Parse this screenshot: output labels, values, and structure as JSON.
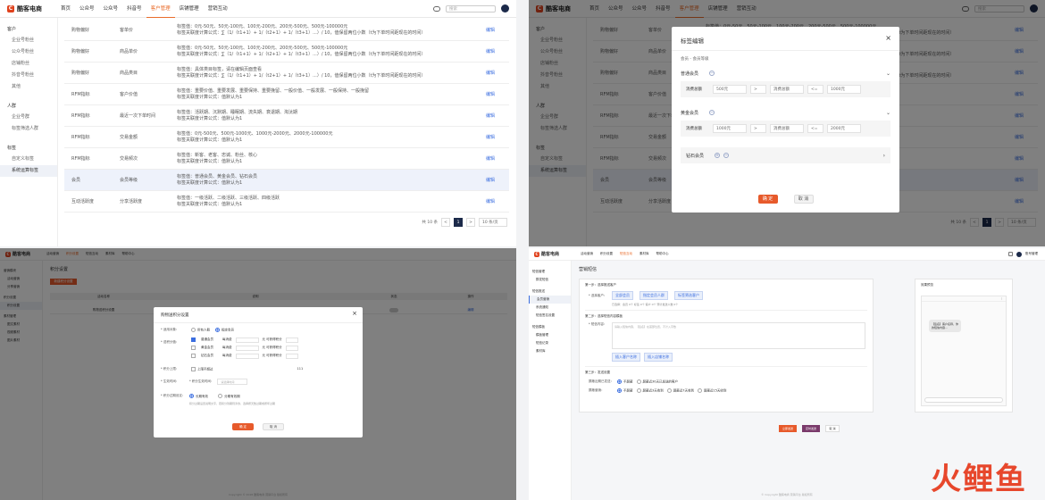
{
  "app": {
    "logo_text": "酷客电商",
    "search_placeholder": "搜索"
  },
  "nav": [
    "首页",
    "公众号",
    "公众号",
    "抖音号",
    "客户管理",
    "店铺管理",
    "营销互动"
  ],
  "nav_active_index": 4,
  "sidebar": {
    "groups": [
      {
        "title": "客户",
        "items": [
          "企业号粉丝",
          "公众号粉丝",
          "店铺粉丝",
          "抖音号粉丝",
          "其他"
        ]
      },
      {
        "title": "人群",
        "items": [
          "企业号群",
          "标签筛选人群"
        ]
      },
      {
        "title": "标签",
        "items": [
          "自定义标签",
          "系统运算标签"
        ]
      }
    ]
  },
  "table_rows": [
    {
      "c1": "购物偏好",
      "c2": "客单价",
      "l1": "标签值：0元-50元、50元-100元、100元-200元、200元-500元、500元-100000元",
      "l2": "标签关联度计算公式：∑（1/（t1+1）+ 1/（t2+1）+ 1/（t3+1）...）/ 10，值保留两位小数（t为下单时间距现在的时间）",
      "edit": "编辑"
    },
    {
      "c1": "购物偏好",
      "c2": "商品单价",
      "l1": "标签值：0元-50元、50元-100元、100元-200元、200元-500元、500元-100000元",
      "l2": "标签关联度计算公式：∑（1/（t1+1）+ 1/（t2+1）+ 1/（t3+1）...）/ 10，值保留两位小数（t为下单时间距现在的时间）",
      "edit": "编辑"
    },
    {
      "c1": "购物偏好",
      "c2": "商品类目",
      "l1": "标签值：具体类目标签，请在编辑页面查看",
      "l2": "标签关联度计算公式：∑（1/（t1+1）+ 1/（t2+1）+ 1/（t3+1）...）/ 10，值保留两位小数（t为下单时间距现在的时间）",
      "edit": "编辑"
    },
    {
      "c1": "RFM指标",
      "c2": "客户价值",
      "l1": "标签值：重要价值、重要发展、重要保持、重要挽留、一般价值、一般发展、一般保持、一般挽留",
      "l2": "标签关联度计算公式：值默认为1",
      "edit": "编辑"
    },
    {
      "c1": "RFM指标",
      "c2": "最近一次下单时间",
      "l1": "标签值：活跃期、沉默期、睡眠期、流失期、衰退期、淘汰期",
      "l2": "标签关联度计算公式：值默认为1",
      "edit": "编辑"
    },
    {
      "c1": "RFM指标",
      "c2": "交易金额",
      "l1": "标签值：0元-500元、500元-1000元、1000元-2000元、2000元-100000元",
      "l2": "标签关联度计算公式：值默认为1",
      "edit": "编辑"
    },
    {
      "c1": "RFM指标",
      "c2": "交易频次",
      "l1": "标签值：新客、老客、忠诚、粉丝、核心",
      "l2": "标签关联度计算公式：值默认为1",
      "edit": "编辑"
    },
    {
      "c1": "会员",
      "c2": "会员等级",
      "l1": "标签值：普通会员、黄金会员、钻石会员",
      "l2": "标签关联度计算公式：值默认为1",
      "edit": "编辑"
    },
    {
      "c1": "互动活跃度",
      "c2": "分享活跃度",
      "l1": "标签值：一级活跃、二级活跃、三级活跃、四级活跃",
      "l2": "标签关联度计算公式：值默认为1",
      "edit": "编辑"
    }
  ],
  "pager": {
    "total": "共 10 条",
    "page": "1",
    "prev": "<",
    "next": ">",
    "per_page": "10 条/页"
  },
  "modal_q2": {
    "title": "标签编辑",
    "subtitle": "会员 - 会员等级",
    "tiers": [
      {
        "name": "普通会员",
        "field": "消费总额",
        "min": "500元",
        "op1": ">",
        "field2": "消费总额",
        "op2": "<=",
        "max": "1000元"
      },
      {
        "name": "黄金会员",
        "field": "消费总额",
        "min": "1000元",
        "op1": ">",
        "field2": "消费总额",
        "op2": "<=",
        "max": "2000元"
      },
      {
        "name": "钻石会员"
      }
    ],
    "ok": "确 定",
    "cancel": "取 消"
  },
  "q3": {
    "logo_text": "酷客电商",
    "nav": [
      "活动营销",
      "积分设置",
      "短信互动",
      "素材库",
      "帮助中心"
    ],
    "page_title": "积分设置",
    "new_button": "新建积分设置",
    "sidebar": [
      "营销模块",
      "活动营销",
      "分享营销",
      "积分设置",
      "积分设置",
      "素材管理",
      "图文素材",
      "视频素材",
      "图片素材"
    ],
    "table_head": [
      "活动名称",
      "说明",
      "状态",
      "操作"
    ],
    "table_row": [
      "购物送积分设置",
      "",
      "",
      "编辑"
    ],
    "modal": {
      "title": "购物送积分设置",
      "r1_label": "* 适用对象：",
      "r1_opt1": "所有人群",
      "r1_opt2": "指定会员",
      "r2_label": "* 送积分值：",
      "tiers": [
        {
          "name": "普通会员",
          "each": "每消费",
          "unit": "元  可获得积分"
        },
        {
          "name": "黄金会员",
          "each": "每消费",
          "unit": "元  可获得积分"
        },
        {
          "name": "钻石会员",
          "each": "每消费",
          "unit": "元  可获得积分"
        }
      ],
      "r3_label": "* 积分上限：",
      "r3_opt": "上限不超过",
      "r3_value": "111",
      "r4_label": "* 生效时间：",
      "r4_sub": "* 积分生效时间：",
      "r4_placeholder": "请选择时间",
      "r5_label": "* 积分过期设定：",
      "r5_opt1": "长期有效",
      "r5_opt2": "分期有效期",
      "r5_note": "积分过期设置说明文字，若积分到期则清零，选择按天数过期或按年过期",
      "ok": "确 定",
      "cancel": "取 消"
    },
    "footer": "Copyright © 2018 酷客电商 营销平台 版权所有"
  },
  "q4": {
    "logo_text": "酷客电商",
    "nav": [
      "活动营销",
      "积分设置",
      "短信互动",
      "素材库",
      "帮助中心"
    ],
    "nav_active_index": 2,
    "user": "账号管理",
    "sidebar": [
      {
        "title": "短信管理",
        "items": [
          "群发短信"
        ]
      },
      {
        "title": "短信推送",
        "items": [
          "会员营销",
          "系统通知",
          "短信签名设置"
        ]
      },
      {
        "title": "短信模板",
        "items": [
          "模板管理",
          "短信记录",
          "素材库"
        ]
      }
    ],
    "page_title": "营销短信",
    "step1": "第一步：选择推送客户",
    "step1_label": "* 选择客户：",
    "step1_btns": [
      "全部会员",
      "指定会员人群",
      "标签筛选客户"
    ],
    "step1_note": "已选择：会员 0个 标签 0个 客户 0个  预计发送人数 0个",
    "step2": "第二步：选择短信内容模板",
    "step2_label": "* 短信内容：",
    "step2_ph": "请输入短信内容，【签名】在首部位置，不计入字数",
    "step2_btns": [
      "插入客户名称",
      "插入店铺名称"
    ],
    "step3": "第三步：发送设置",
    "step3_r1_label": "屏蔽近期已发送：",
    "step3_r1_opts": [
      "不屏蔽",
      "屏蔽近30天已发送的客户"
    ],
    "step3_r2_label": "屏蔽营销：",
    "step3_r2_opts": [
      "不屏蔽",
      "屏蔽近3天收到",
      "屏蔽近7天收到",
      "屏蔽近15天收到"
    ],
    "preview_title": "效果预览",
    "phone_msg": "【签名】客户名称，你的短信内容...",
    "btn_send": "立即发送",
    "btn_schedule": "定时发送",
    "btn_cancel": "取 消",
    "footer": "© Copyright 酷客电商 营销平台 版权所有"
  },
  "watermark": "火鲤鱼"
}
